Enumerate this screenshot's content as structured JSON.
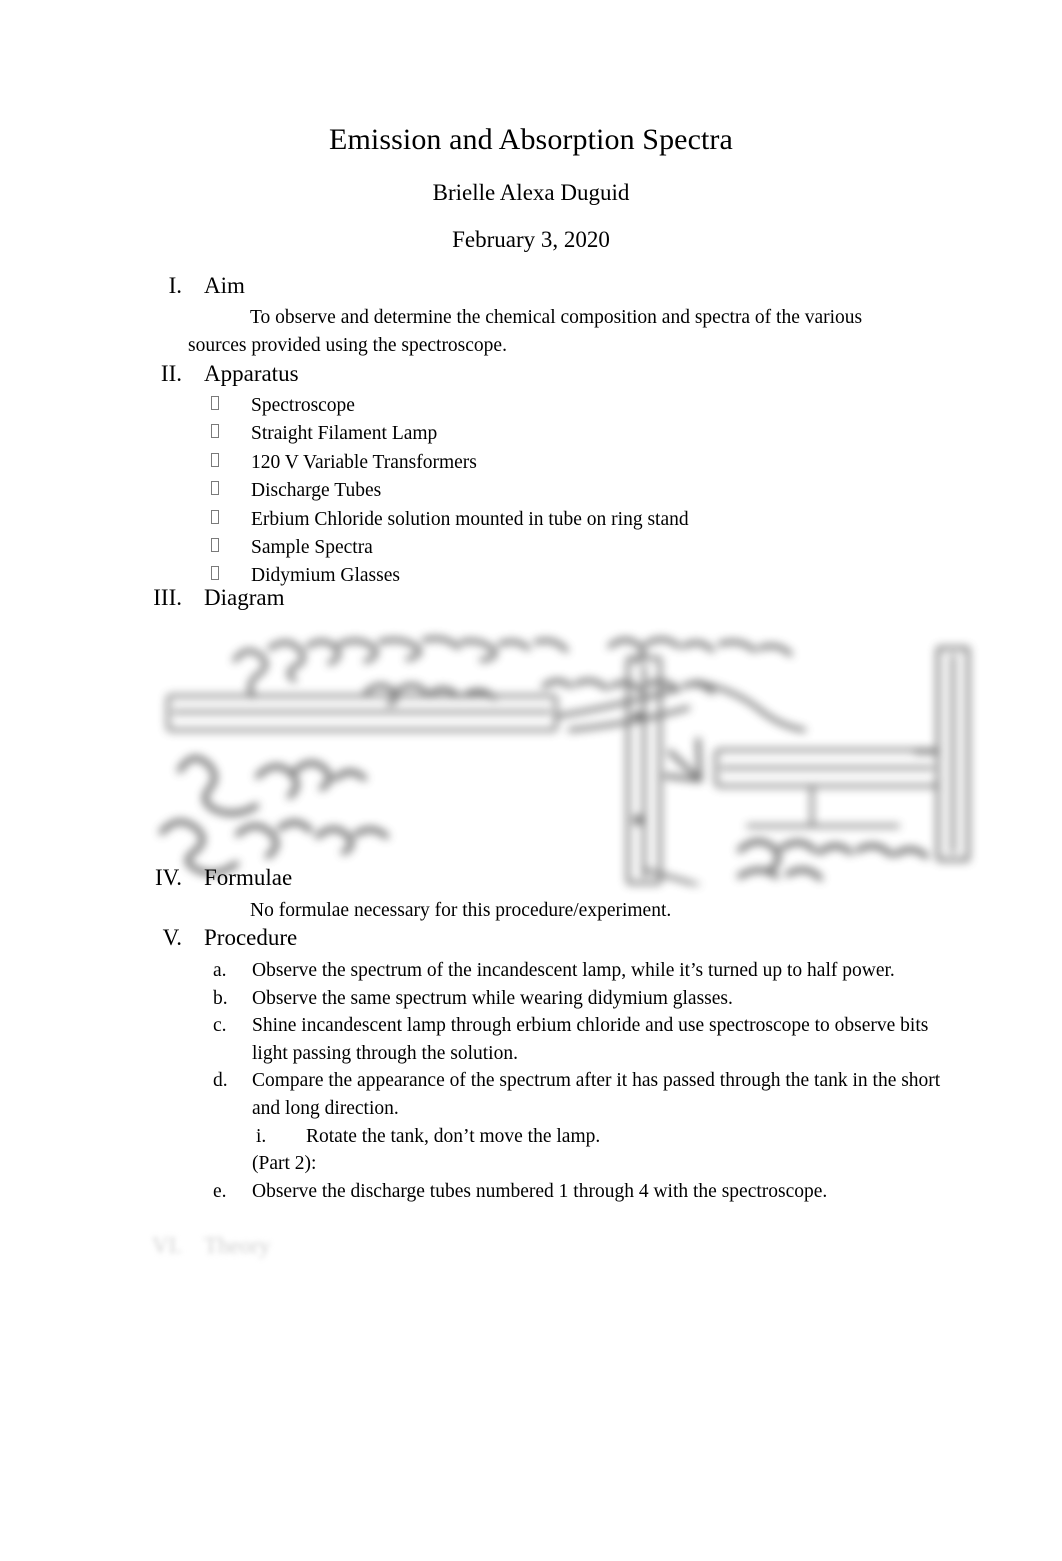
{
  "document": {
    "title": "Emission and Absorption Spectra",
    "author": "Brielle Alexa Duguid",
    "date": "February 3, 2020",
    "page_background": "#ffffff",
    "text_color": "#000000"
  },
  "sections": [
    {
      "numeral": "I.",
      "label": "Aim",
      "paragraph": "To observe and determine the chemical composition and spectra of the various sources provided using the spectroscope."
    },
    {
      "numeral": "II.",
      "label": "Apparatus",
      "bullet_glyph": "tofu-box",
      "items": [
        "Spectroscope",
        "Straight Filament Lamp",
        "120 V Variable Transformers",
        "Discharge Tubes",
        "Erbium Chloride solution mounted in tube on ring stand",
        "Sample Spectra",
        "Didymium Glasses"
      ]
    },
    {
      "numeral": "III.",
      "label": "Diagram",
      "figure": {
        "name": "hand-drawn-apparatus-sketch",
        "description": "Blurred hand-drawn pencil sketch of lamp, tank and spectroscope on ring stands",
        "legible": false
      }
    },
    {
      "numeral": "IV.",
      "label": "Formulae",
      "paragraph": "No formulae necessary for this procedure/experiment."
    },
    {
      "numeral": "V.",
      "label": "Procedure",
      "steps": [
        {
          "mark": "a.",
          "text": "Observe the spectrum of the incandescent lamp, while it’s turned up to half power."
        },
        {
          "mark": "b.",
          "text": "Observe the same spectrum while wearing didymium glasses."
        },
        {
          "mark": "c.",
          "text": "Shine incandescent lamp through erbium chloride and use spectroscope to observe bits light passing through the solution."
        },
        {
          "mark": "d.",
          "text": "Compare the appearance of the spectrum after it has passed through the tank in the short and long direction."
        }
      ],
      "substep": {
        "mark": "i.",
        "text": "Rotate the tank, don’t move the lamp."
      },
      "part_divider": "(Part 2):",
      "steps_continued": [
        {
          "mark": "e.",
          "text": "Observe the discharge tubes numbered 1 through 4 with the spectroscope."
        }
      ]
    },
    {
      "numeral": "VI.",
      "label": "Theory",
      "faded": true
    }
  ]
}
